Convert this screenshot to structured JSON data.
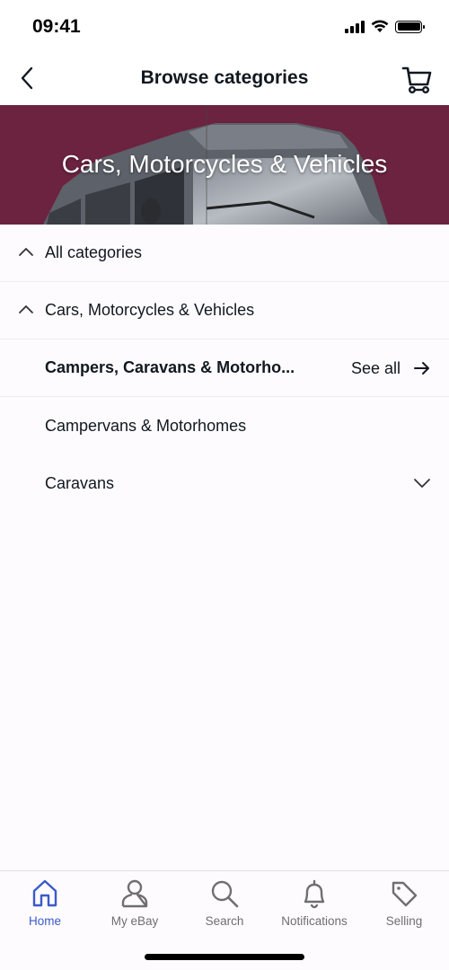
{
  "status_bar": {
    "time": "09:41",
    "icons": [
      "signal-icon",
      "wifi-icon",
      "battery-icon"
    ]
  },
  "nav": {
    "title": "Browse categories",
    "back_icon": "chevron-left-icon",
    "cart_icon": "cart-icon"
  },
  "hero": {
    "title": "Cars, Motorcycles & Vehicles",
    "background_color": "#6c2340"
  },
  "categories": [
    {
      "label": "All categories",
      "icon": "chevron-up-icon"
    },
    {
      "label": "Cars, Motorcycles & Vehicles",
      "icon": "chevron-up-icon"
    },
    {
      "label": "Campers, Caravans & Motorho...",
      "see_all_label": "See all",
      "see_all_icon": "arrow-right-icon"
    },
    {
      "label": "Campervans & Motorhomes"
    },
    {
      "label": "Caravans",
      "icon": "chevron-down-icon"
    }
  ],
  "tab_bar": {
    "active_color": "#3b5bc8",
    "inactive_color": "#6e6e73",
    "tabs": [
      {
        "label": "Home",
        "icon": "home-icon",
        "active": true
      },
      {
        "label": "My eBay",
        "icon": "person-icon",
        "active": false
      },
      {
        "label": "Search",
        "icon": "search-icon",
        "active": false
      },
      {
        "label": "Notifications",
        "icon": "bell-icon",
        "active": false
      },
      {
        "label": "Selling",
        "icon": "tag-icon",
        "active": false
      }
    ]
  }
}
